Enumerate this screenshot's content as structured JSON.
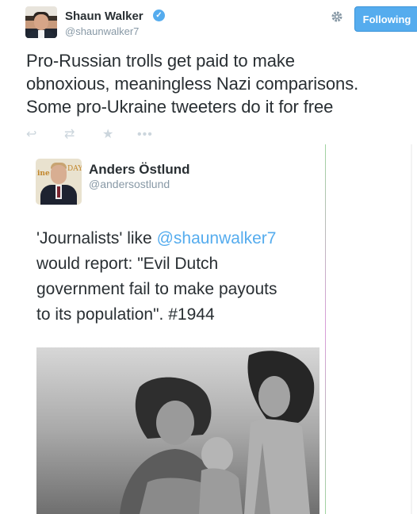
{
  "tweet": {
    "author_name": "Shaun Walker",
    "author_handle": "@shaunwalker7",
    "verified_glyph": "✓",
    "follow_label": "Following",
    "settings_icon": "gear-icon",
    "text_lines": [
      "Pro-Russian trolls get paid to make",
      "obnoxious, meaningless Nazi comparisons.",
      "Some pro-Ukraine tweeters do it for free"
    ],
    "actions": {
      "reply_icon": "↩",
      "retweet_icon": "⇄",
      "favorite_icon": "★",
      "more_icon": "•••"
    }
  },
  "embedded": {
    "author_name": "Anders Östlund",
    "author_handle": "@andersostlund",
    "avatar_text_left": "ine",
    "avatar_text_right": "DAY",
    "text_line1_pre": "'Journalists' like ",
    "text_line1_mention": "@shaunwalker7",
    "text_lines_rest": [
      "would report: \"Evil Dutch",
      "government fail to make payouts",
      "to its population\". #1944"
    ],
    "photo_label": "black-and-white photograph"
  },
  "colors": {
    "accent": "#55acee",
    "text": "#292f33",
    "muted": "#8899a6"
  }
}
